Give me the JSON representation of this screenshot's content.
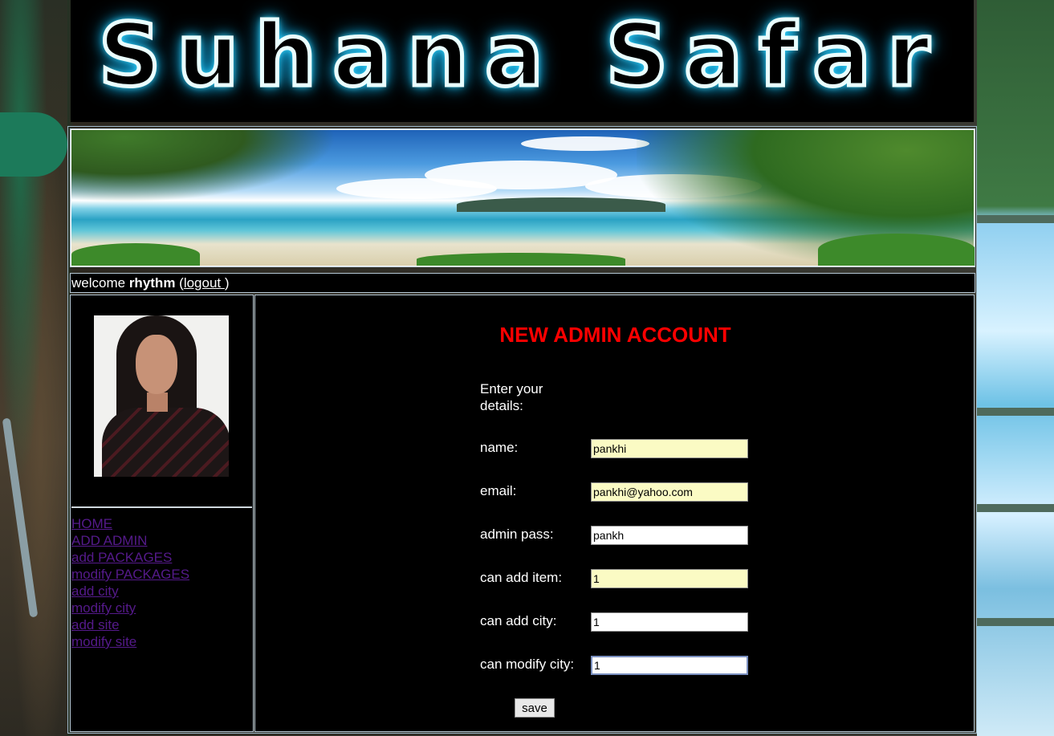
{
  "site": {
    "logo_text": "Suhana Safar"
  },
  "welcome": {
    "prefix": "welcome ",
    "username": "rhythm",
    "open_paren": " (",
    "logout_label": "logout ",
    "close_paren": ")"
  },
  "sidebar": {
    "nav": [
      {
        "label": "HOME"
      },
      {
        "label": "ADD ADMIN"
      },
      {
        "label": "add PACKAGES"
      },
      {
        "label": "modify PACKAGES"
      },
      {
        "label": "add city"
      },
      {
        "label": "modify city"
      },
      {
        "label": "add site"
      },
      {
        "label": "modify site"
      }
    ]
  },
  "form": {
    "title": "NEW ADMIN ACCOUNT",
    "intro": "Enter your details:",
    "fields": [
      {
        "label": "name:",
        "value": "pankhi"
      },
      {
        "label": "email:",
        "value": "pankhi@yahoo.com"
      },
      {
        "label": "admin pass:",
        "value": "pankh"
      },
      {
        "label": "can add item:",
        "value": "1"
      },
      {
        "label": "can add city:",
        "value": "1"
      },
      {
        "label": "can modify city:",
        "value": "1"
      }
    ],
    "save_label": "save"
  },
  "colors": {
    "title": "#ff0000",
    "link": "#551a8b",
    "autofill": "#fbfbc4",
    "logo_glow": "#1fc8ff"
  }
}
